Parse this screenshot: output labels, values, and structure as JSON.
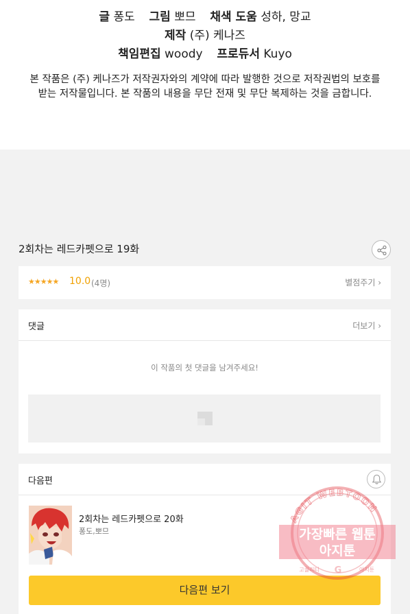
{
  "credits": {
    "story_label": "글",
    "story_value": "퐁도",
    "art_label": "그림",
    "art_value": "뽀므",
    "color_label": "채색 도움",
    "color_value": "성하, 망교",
    "production_label": "제작",
    "production_value": "(주) 케나즈",
    "editor_label": "책임편집",
    "editor_value": "woody",
    "producer_label": "프로듀서",
    "producer_value": "Kuyo"
  },
  "copyright": {
    "line1": "본 작품은 (주) 케나즈가 저작권자와의 계약에 따라 발행한 것으로 저작권법의 보호를",
    "line2": "받는 저작물입니다. 본 작품의 내용을 무단 전재 및 무단 복제하는 것을 금합니다."
  },
  "episode": {
    "title": "2회차는 레드카펫으로 19화",
    "share_icon": "share-icon"
  },
  "rating": {
    "stars": "★★★★★",
    "score": "10.0",
    "count": "(4명)",
    "rate_link": "별점주기 ›"
  },
  "comments": {
    "title": "댓글",
    "more_link": "더보기 ›",
    "empty_message": "이 작품의 첫 댓글을 남겨주세요!"
  },
  "next_episode": {
    "section_title": "다음편",
    "bell_icon": "bell-icon",
    "title": "2회차는 레드카펫으로 20화",
    "authors": "퐁도,뽀므",
    "button_label": "다음편 보기"
  },
  "watermark": {
    "arc_text": "AGIT WEBTOON",
    "line1": "가장빠른 웹툰",
    "line2": "아지툰",
    "left_small": "고퀄리티",
    "right_small": "아지툰"
  },
  "colors": {
    "accent_yellow": "#fcc92a",
    "star": "#f5a623",
    "watermark_red": "#e0303a"
  }
}
